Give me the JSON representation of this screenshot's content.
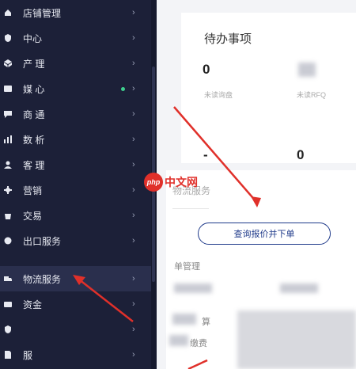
{
  "sidebar": {
    "items": [
      {
        "label": "店铺管理",
        "icon": "home-icon"
      },
      {
        "label": "中心",
        "icon": "shield-icon"
      },
      {
        "label": "产 理",
        "icon": "box-icon"
      },
      {
        "label": "媒 心",
        "icon": "media-icon"
      },
      {
        "label": "商 通",
        "icon": "chat-icon"
      },
      {
        "label": "数 析",
        "icon": "bar-chart-icon"
      },
      {
        "label": "客 理",
        "icon": "customer-icon"
      },
      {
        "label": "营销",
        "icon": "gear-icon"
      },
      {
        "label": "交易",
        "icon": "bag-icon"
      },
      {
        "label": "出口服务",
        "icon": "export-icon"
      },
      {
        "label": "物流服务",
        "icon": "truck-icon"
      },
      {
        "label": "资金",
        "icon": "wallet-icon"
      },
      {
        "label": "",
        "icon": "shield-icon"
      },
      {
        "label": "服",
        "icon": "doc-icon"
      }
    ],
    "chevron": "›"
  },
  "todo": {
    "title": "待办事项",
    "stats": [
      {
        "value": "0",
        "label": "未读询盘"
      },
      {
        "value": "",
        "label": "未读RFQ"
      },
      {
        "value": "-",
        "label": ""
      },
      {
        "value": "0",
        "label": ""
      }
    ]
  },
  "logistics": {
    "title": "物流服务",
    "order_button": "查询报价并下单",
    "order_mgmt_label": "单管理",
    "fee_label": "缴费",
    "item_label": "算"
  },
  "watermark": {
    "badge": "php",
    "text": "中文网"
  },
  "colors": {
    "sidebar_bg": "#1c2038",
    "accent": "#1f3a8a",
    "arrow": "#e0302a",
    "dot": "#3ecf8e"
  }
}
